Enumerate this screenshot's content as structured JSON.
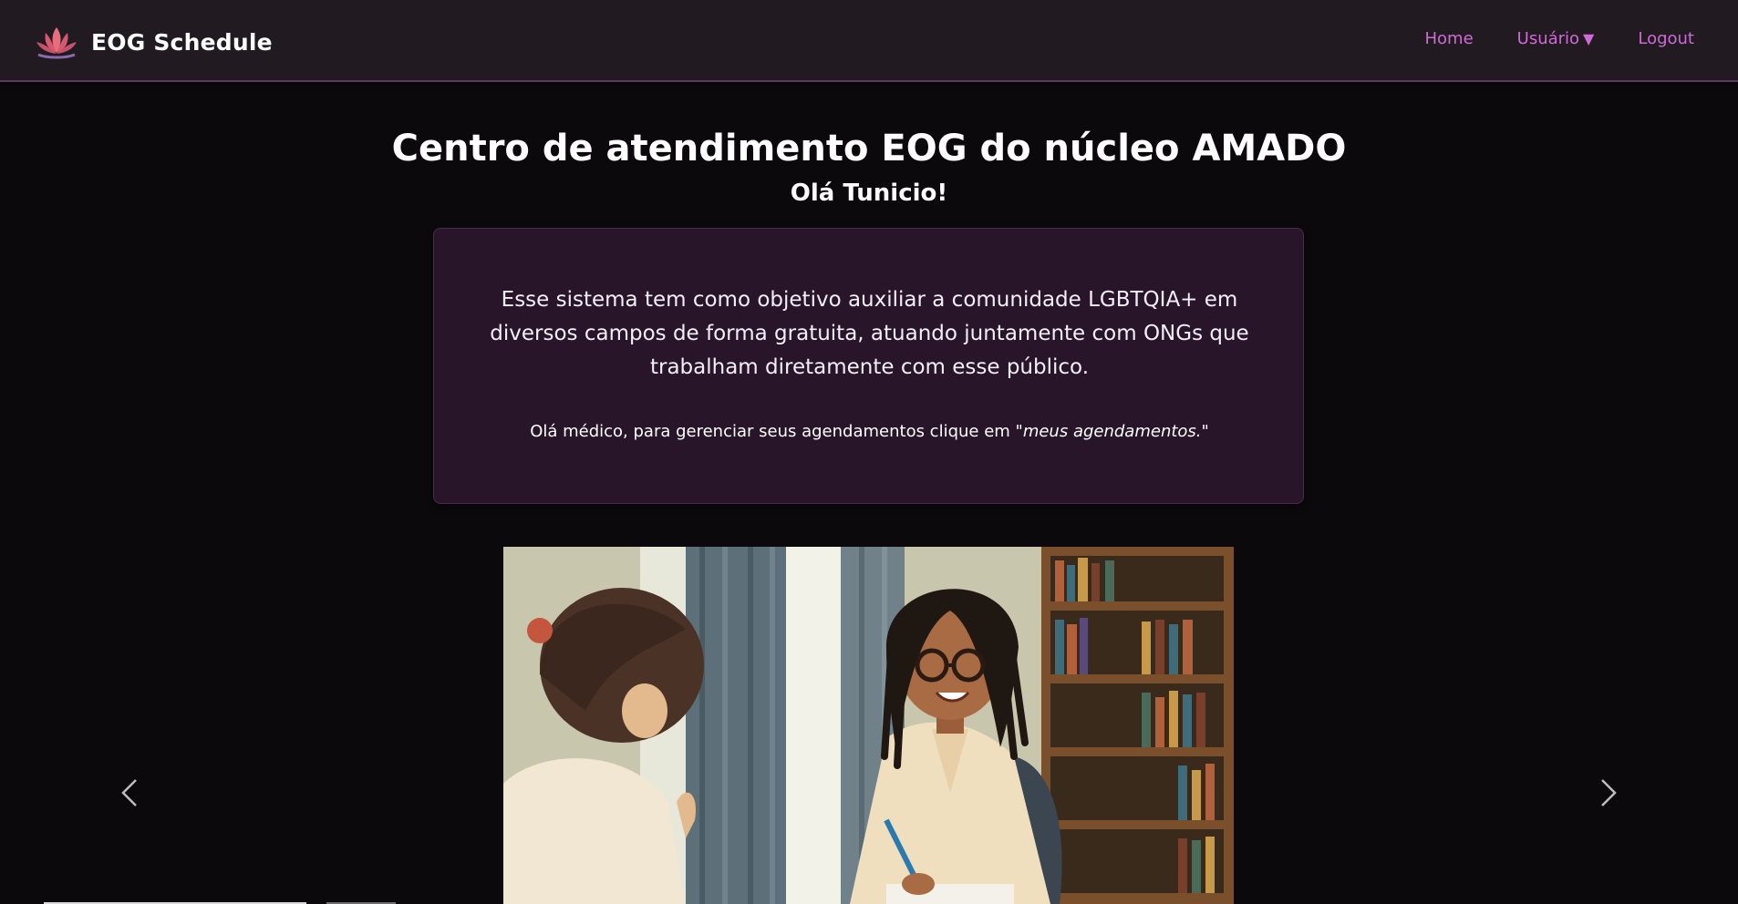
{
  "app": {
    "brand_name": "EOG Schedule",
    "logo_icon": "lotus-icon",
    "accent_color": "#d06ad6"
  },
  "nav": {
    "home": "Home",
    "user": "Usuário",
    "user_caret": "▼",
    "logout": "Logout"
  },
  "page": {
    "title": "Centro de atendimento EOG do núcleo AMADO",
    "greeting": "Olá Tunicio!"
  },
  "info_card": {
    "description": "Esse sistema tem como objetivo auxiliar a comunidade LGBTQIA+ em diversos campos de forma gratuita, atuando juntamente com ONGs que trabalham diretamente com esse público.",
    "note_prefix": "Olá médico, para gerenciar seus agendamentos clique em ",
    "note_link": "\"meus agendamentos.\""
  },
  "carousel": {
    "prev_icon": "chevron-left-icon",
    "next_icon": "chevron-right-icon",
    "slide_icon": "illustration-consultation"
  }
}
